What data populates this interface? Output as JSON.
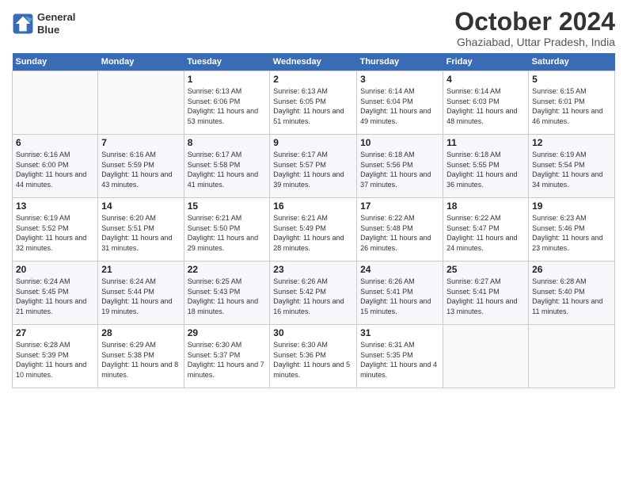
{
  "logo": {
    "line1": "General",
    "line2": "Blue"
  },
  "title": "October 2024",
  "location": "Ghaziabad, Uttar Pradesh, India",
  "headers": [
    "Sunday",
    "Monday",
    "Tuesday",
    "Wednesday",
    "Thursday",
    "Friday",
    "Saturday"
  ],
  "weeks": [
    [
      {
        "day": "",
        "sunrise": "",
        "sunset": "",
        "daylight": ""
      },
      {
        "day": "",
        "sunrise": "",
        "sunset": "",
        "daylight": ""
      },
      {
        "day": "1",
        "sunrise": "Sunrise: 6:13 AM",
        "sunset": "Sunset: 6:06 PM",
        "daylight": "Daylight: 11 hours and 53 minutes."
      },
      {
        "day": "2",
        "sunrise": "Sunrise: 6:13 AM",
        "sunset": "Sunset: 6:05 PM",
        "daylight": "Daylight: 11 hours and 51 minutes."
      },
      {
        "day": "3",
        "sunrise": "Sunrise: 6:14 AM",
        "sunset": "Sunset: 6:04 PM",
        "daylight": "Daylight: 11 hours and 49 minutes."
      },
      {
        "day": "4",
        "sunrise": "Sunrise: 6:14 AM",
        "sunset": "Sunset: 6:03 PM",
        "daylight": "Daylight: 11 hours and 48 minutes."
      },
      {
        "day": "5",
        "sunrise": "Sunrise: 6:15 AM",
        "sunset": "Sunset: 6:01 PM",
        "daylight": "Daylight: 11 hours and 46 minutes."
      }
    ],
    [
      {
        "day": "6",
        "sunrise": "Sunrise: 6:16 AM",
        "sunset": "Sunset: 6:00 PM",
        "daylight": "Daylight: 11 hours and 44 minutes."
      },
      {
        "day": "7",
        "sunrise": "Sunrise: 6:16 AM",
        "sunset": "Sunset: 5:59 PM",
        "daylight": "Daylight: 11 hours and 43 minutes."
      },
      {
        "day": "8",
        "sunrise": "Sunrise: 6:17 AM",
        "sunset": "Sunset: 5:58 PM",
        "daylight": "Daylight: 11 hours and 41 minutes."
      },
      {
        "day": "9",
        "sunrise": "Sunrise: 6:17 AM",
        "sunset": "Sunset: 5:57 PM",
        "daylight": "Daylight: 11 hours and 39 minutes."
      },
      {
        "day": "10",
        "sunrise": "Sunrise: 6:18 AM",
        "sunset": "Sunset: 5:56 PM",
        "daylight": "Daylight: 11 hours and 37 minutes."
      },
      {
        "day": "11",
        "sunrise": "Sunrise: 6:18 AM",
        "sunset": "Sunset: 5:55 PM",
        "daylight": "Daylight: 11 hours and 36 minutes."
      },
      {
        "day": "12",
        "sunrise": "Sunrise: 6:19 AM",
        "sunset": "Sunset: 5:54 PM",
        "daylight": "Daylight: 11 hours and 34 minutes."
      }
    ],
    [
      {
        "day": "13",
        "sunrise": "Sunrise: 6:19 AM",
        "sunset": "Sunset: 5:52 PM",
        "daylight": "Daylight: 11 hours and 32 minutes."
      },
      {
        "day": "14",
        "sunrise": "Sunrise: 6:20 AM",
        "sunset": "Sunset: 5:51 PM",
        "daylight": "Daylight: 11 hours and 31 minutes."
      },
      {
        "day": "15",
        "sunrise": "Sunrise: 6:21 AM",
        "sunset": "Sunset: 5:50 PM",
        "daylight": "Daylight: 11 hours and 29 minutes."
      },
      {
        "day": "16",
        "sunrise": "Sunrise: 6:21 AM",
        "sunset": "Sunset: 5:49 PM",
        "daylight": "Daylight: 11 hours and 28 minutes."
      },
      {
        "day": "17",
        "sunrise": "Sunrise: 6:22 AM",
        "sunset": "Sunset: 5:48 PM",
        "daylight": "Daylight: 11 hours and 26 minutes."
      },
      {
        "day": "18",
        "sunrise": "Sunrise: 6:22 AM",
        "sunset": "Sunset: 5:47 PM",
        "daylight": "Daylight: 11 hours and 24 minutes."
      },
      {
        "day": "19",
        "sunrise": "Sunrise: 6:23 AM",
        "sunset": "Sunset: 5:46 PM",
        "daylight": "Daylight: 11 hours and 23 minutes."
      }
    ],
    [
      {
        "day": "20",
        "sunrise": "Sunrise: 6:24 AM",
        "sunset": "Sunset: 5:45 PM",
        "daylight": "Daylight: 11 hours and 21 minutes."
      },
      {
        "day": "21",
        "sunrise": "Sunrise: 6:24 AM",
        "sunset": "Sunset: 5:44 PM",
        "daylight": "Daylight: 11 hours and 19 minutes."
      },
      {
        "day": "22",
        "sunrise": "Sunrise: 6:25 AM",
        "sunset": "Sunset: 5:43 PM",
        "daylight": "Daylight: 11 hours and 18 minutes."
      },
      {
        "day": "23",
        "sunrise": "Sunrise: 6:26 AM",
        "sunset": "Sunset: 5:42 PM",
        "daylight": "Daylight: 11 hours and 16 minutes."
      },
      {
        "day": "24",
        "sunrise": "Sunrise: 6:26 AM",
        "sunset": "Sunset: 5:41 PM",
        "daylight": "Daylight: 11 hours and 15 minutes."
      },
      {
        "day": "25",
        "sunrise": "Sunrise: 6:27 AM",
        "sunset": "Sunset: 5:41 PM",
        "daylight": "Daylight: 11 hours and 13 minutes."
      },
      {
        "day": "26",
        "sunrise": "Sunrise: 6:28 AM",
        "sunset": "Sunset: 5:40 PM",
        "daylight": "Daylight: 11 hours and 11 minutes."
      }
    ],
    [
      {
        "day": "27",
        "sunrise": "Sunrise: 6:28 AM",
        "sunset": "Sunset: 5:39 PM",
        "daylight": "Daylight: 11 hours and 10 minutes."
      },
      {
        "day": "28",
        "sunrise": "Sunrise: 6:29 AM",
        "sunset": "Sunset: 5:38 PM",
        "daylight": "Daylight: 11 hours and 8 minutes."
      },
      {
        "day": "29",
        "sunrise": "Sunrise: 6:30 AM",
        "sunset": "Sunset: 5:37 PM",
        "daylight": "Daylight: 11 hours and 7 minutes."
      },
      {
        "day": "30",
        "sunrise": "Sunrise: 6:30 AM",
        "sunset": "Sunset: 5:36 PM",
        "daylight": "Daylight: 11 hours and 5 minutes."
      },
      {
        "day": "31",
        "sunrise": "Sunrise: 6:31 AM",
        "sunset": "Sunset: 5:35 PM",
        "daylight": "Daylight: 11 hours and 4 minutes."
      },
      {
        "day": "",
        "sunrise": "",
        "sunset": "",
        "daylight": ""
      },
      {
        "day": "",
        "sunrise": "",
        "sunset": "",
        "daylight": ""
      }
    ]
  ]
}
